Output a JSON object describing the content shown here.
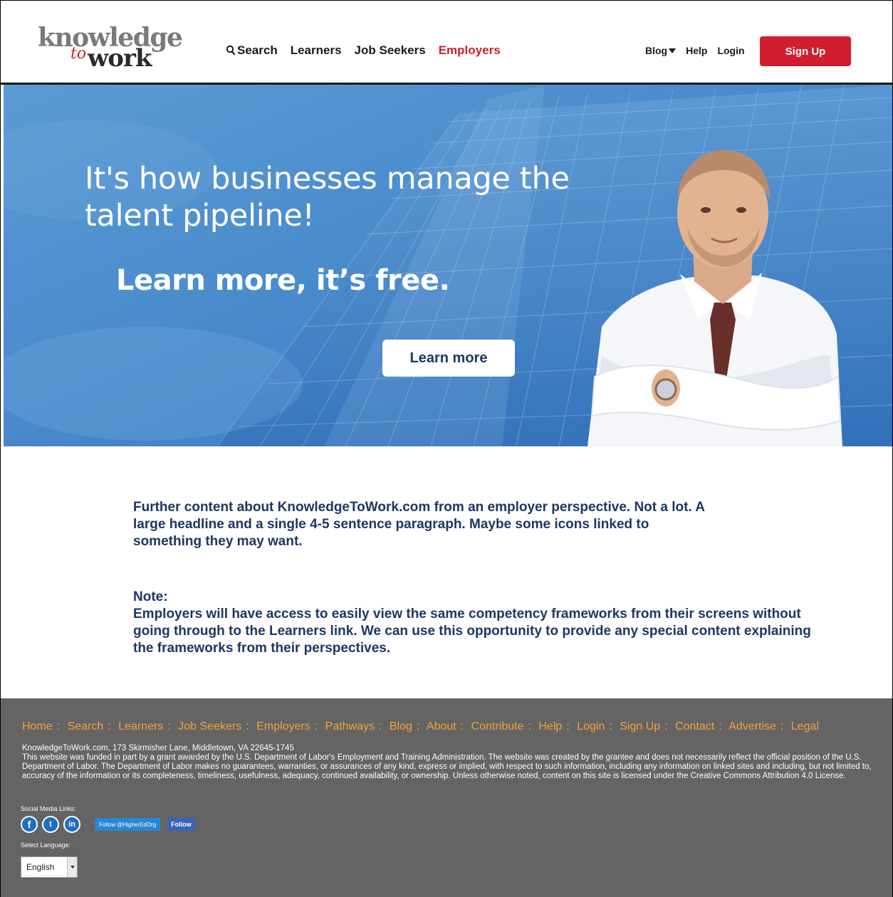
{
  "header": {
    "logo": {
      "line1": "knowledge",
      "to": "to",
      "line2": "work"
    },
    "nav": [
      "Search",
      "Learners",
      "Job Seekers",
      "Employers"
    ],
    "right_nav": {
      "blog": "Blog",
      "help": "Help",
      "login": "Login"
    },
    "signup_label": "Sign Up"
  },
  "hero": {
    "headline": "It's how businesses manage the talent pipeline!",
    "subheadline": "Learn more, it’s free.",
    "button_label": "Learn more"
  },
  "content": {
    "paragraph1": "Further content about KnowledgeToWork.com from an employer perspective. Not a lot. A large headline and a single 4-5 sentence paragraph. Maybe some icons linked to something they may want.",
    "note_title": "Note:",
    "note_body": "Employers will have access to easily view the same competency frameworks from their screens without going through to the Learners link. We can use this opportunity to provide any special content explaining the frameworks from their perspectives."
  },
  "footer": {
    "links": [
      "Home",
      "Search",
      "Learners",
      "Job Seekers",
      "Employers",
      "Pathways",
      "Blog",
      "About",
      "Contribute",
      "Help",
      "Login",
      "Sign Up",
      "Contact",
      "Advertise",
      "Legal"
    ],
    "separator": ":",
    "address": "KnowledgeToWork.com, 173 Skirmisher Lane, Middletown, VA 22645-1745",
    "disclaimer": "This website was funded in part by a grant awarded by the U.S. Department of Labor's Employment and Training Administration. The website was created by the grantee and does not necessarily reflect the official position of the U.S. Department of Labor. The Department of Labor makes no guarantees, warranties, or assurances of any kind, express or implied, with respect to such information, including any information on linked sites and including, but not limited to, accuracy of the information or its completeness, timeliness, usefulness, adequacy, continued availability, or ownership. Unless otherwise noted, content on this site is licensed under the Creative Commons Attribution 4.0 License.",
    "social_label": "Social Media Links:",
    "social_icons": [
      "facebook-icon",
      "twitter-icon",
      "linkedin-icon"
    ],
    "twitter_follow": "Follow @HigherEdOrg",
    "facebook_follow": "Follow",
    "language_label": "Select Language:",
    "language_value": "English"
  },
  "colors": {
    "brand_red": "#cf1f2e",
    "hero_blue": "#3f86cc",
    "content_navy": "#1d3763",
    "footer_bg": "#646464",
    "footer_link": "#f2a23a"
  }
}
